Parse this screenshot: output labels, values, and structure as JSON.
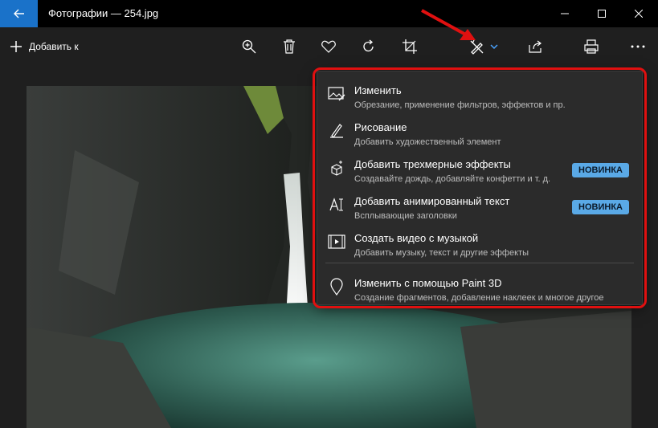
{
  "window": {
    "title": "Фотографии — 254.jpg"
  },
  "toolbar": {
    "add_label": "Добавить к"
  },
  "menu": {
    "items": [
      {
        "title": "Изменить",
        "subtitle": "Обрезание, применение фильтров, эффектов и пр.",
        "icon": "edit-image-icon",
        "badge": ""
      },
      {
        "title": "Рисование",
        "subtitle": "Добавить художественный элемент",
        "icon": "draw-pen-icon",
        "badge": ""
      },
      {
        "title": "Добавить трехмерные эффекты",
        "subtitle": "Создавайте дождь, добавляйте конфетти и т. д.",
        "icon": "3d-effects-icon",
        "badge": "НОВИНКА"
      },
      {
        "title": "Добавить анимированный текст",
        "subtitle": "Всплывающие заголовки",
        "icon": "animated-text-icon",
        "badge": "НОВИНКА"
      },
      {
        "title": "Создать видео с музыкой",
        "subtitle": "Добавить музыку, текст и другие эффекты",
        "icon": "video-music-icon",
        "badge": ""
      },
      {
        "title": "Изменить с помощью Paint 3D",
        "subtitle": "Создание фрагментов, добавление наклеек и многое другое",
        "icon": "paint3d-icon",
        "badge": ""
      }
    ]
  },
  "colors": {
    "accent": "#1a72c9",
    "badge": "#5aa9e6",
    "highlight": "#e01010"
  }
}
